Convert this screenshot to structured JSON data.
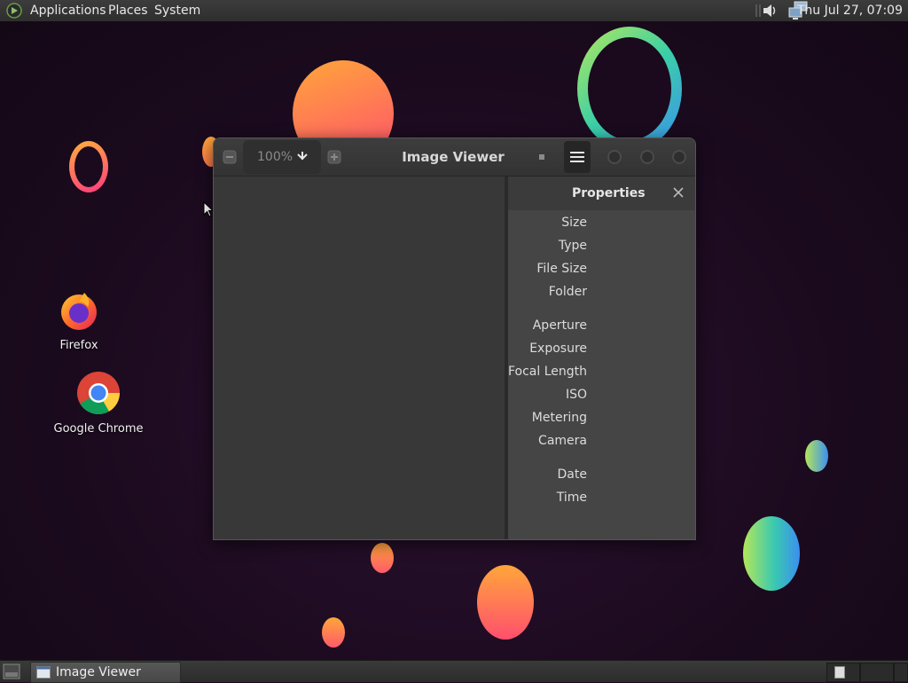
{
  "top_panel": {
    "menus": [
      "Applications",
      "Places",
      "System"
    ],
    "clock": "Thu Jul 27, 07:09"
  },
  "desktop_icons": [
    {
      "label": "Firefox",
      "icon": "firefox-icon"
    },
    {
      "label": "Google Chrome",
      "icon": "chrome-icon"
    }
  ],
  "window": {
    "title": "Image Viewer",
    "zoom": "100%",
    "properties": {
      "title": "Properties",
      "groups": [
        [
          "Size",
          "Type",
          "File Size",
          "Folder"
        ],
        [
          "Aperture",
          "Exposure",
          "Focal Length",
          "ISO",
          "Metering",
          "Camera"
        ],
        [
          "Date",
          "Time"
        ]
      ]
    }
  },
  "taskbar": {
    "tasks": [
      {
        "label": "Image Viewer",
        "icon": "window-icon"
      }
    ]
  },
  "colors": {
    "panel": "#333333",
    "window_bg": "#363636",
    "sidebar_bg": "#454545",
    "desktop_bg": "#1c0c1f"
  }
}
